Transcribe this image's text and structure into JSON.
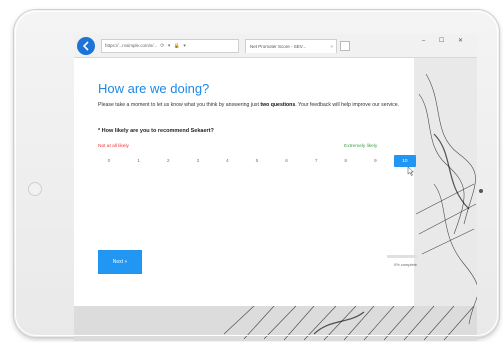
{
  "browser": {
    "address": "https://...rvsimple.com/s/...",
    "tab_title": "Net Promoter Score - SEV...",
    "tab_close": "×",
    "window_controls": "–  ☐  ✕",
    "address_icons": "⟳ ▾ 🔒 ▾",
    "back_icon": "back-arrow-icon"
  },
  "survey": {
    "title": "How are we doing?",
    "intro_prefix": "Please take a moment to let us know what you think by answering just ",
    "intro_bold": "two questions",
    "intro_suffix": ". Your feedback will help improve our service.",
    "question": "* How likely are you to recommend Sekaert?",
    "label_low": "Not at all likely",
    "label_high": "Extremely likely",
    "scale": [
      "0",
      "1",
      "2",
      "3",
      "4",
      "5",
      "6",
      "7",
      "8",
      "9",
      "10"
    ],
    "selected_value": "10",
    "next_label": "Next »",
    "progress_text": "0% complete",
    "progress_fraction": 0.0
  },
  "colors": {
    "accent": "#2196f3",
    "title": "#1e88e5",
    "low": "#e53935",
    "high": "#43a047"
  }
}
